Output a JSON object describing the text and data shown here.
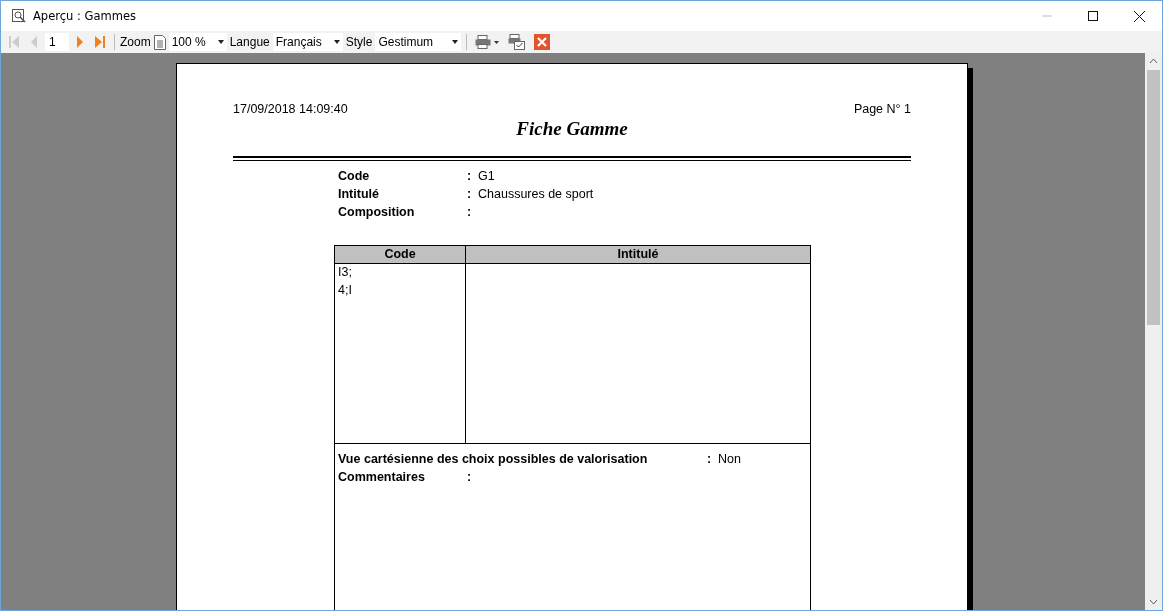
{
  "window": {
    "title": "Aperçu : Gammes"
  },
  "toolbar": {
    "nav": [
      {
        "kind": "first",
        "disabled": true
      },
      {
        "kind": "prev",
        "disabled": true
      },
      {
        "kind": "page",
        "value": "1"
      },
      {
        "kind": "next",
        "disabled": false
      },
      {
        "kind": "last",
        "disabled": false
      }
    ],
    "zoom_label": "Zoom",
    "zoom": "100 %",
    "language_label": "Langue",
    "language": "Français",
    "style_label": "Style",
    "style": "Gestimum"
  },
  "report": {
    "date": "17/09/2018 14:09:40",
    "page": "Page N° 1",
    "title": "Fiche Gamme",
    "fields": [
      {
        "label": "Code",
        "separator": ":",
        "value": "G1"
      },
      {
        "label": "Intitulé",
        "separator": ":",
        "value": "Chaussures de sport"
      },
      {
        "label": "Composition",
        "separator": ":"
      }
    ],
    "table": {
      "columns": [
        "Code",
        "Intitulé"
      ],
      "rows": [
        [
          "I3;"
        ],
        [
          "4;I"
        ]
      ]
    },
    "footer_fields": [
      {
        "label": "Vue cartésienne des choix possibles de valorisation",
        "separator": ":",
        "value": "Non"
      },
      {
        "label": "Commentaires",
        "separator": ":"
      }
    ]
  }
}
